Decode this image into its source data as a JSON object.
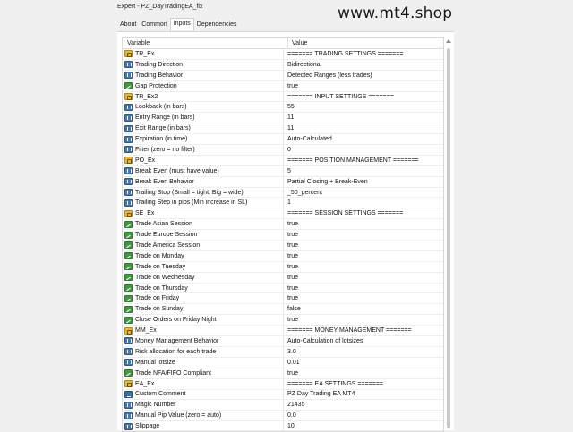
{
  "window": {
    "title": "Expert - PZ_DayTradingEA_fix",
    "watermark": "www.mt4.shop"
  },
  "tabs": [
    {
      "label": "About",
      "active": false
    },
    {
      "label": "Common",
      "active": false
    },
    {
      "label": "Inputs",
      "active": true
    },
    {
      "label": "Dependencies",
      "active": false
    }
  ],
  "table": {
    "col_variable": "Variable",
    "col_value": "Value",
    "rows": [
      {
        "icon": "str",
        "name": "TR_Ex",
        "value": "======= TRADING SETTINGS ======="
      },
      {
        "icon": "num",
        "name": "Trading Direction",
        "value": "Bidirectional"
      },
      {
        "icon": "num",
        "name": "Trading Behavior",
        "value": "Detected Ranges (less trades)"
      },
      {
        "icon": "bool",
        "name": "Gap Protection",
        "value": "true"
      },
      {
        "icon": "str",
        "name": "TR_Ex2",
        "value": "======= INPUT SETTINGS ======="
      },
      {
        "icon": "num",
        "name": "Lookback (in bars)",
        "value": "55"
      },
      {
        "icon": "num",
        "name": "Entry Range (in bars)",
        "value": "11"
      },
      {
        "icon": "num",
        "name": "Exit Range (in bars)",
        "value": "11"
      },
      {
        "icon": "num",
        "name": "Expiration (in time)",
        "value": "Auto-Calculated"
      },
      {
        "icon": "num",
        "name": "Filter (zero = no filter)",
        "value": "0"
      },
      {
        "icon": "str",
        "name": "PO_Ex",
        "value": "======= POSITION MANAGEMENT ======="
      },
      {
        "icon": "num",
        "name": "Break Even (must have value)",
        "value": "5"
      },
      {
        "icon": "num",
        "name": "Break Even Behavior",
        "value": "Partial Closing + Break-Even"
      },
      {
        "icon": "num",
        "name": "Trailing Stop (Small = tight, Big = wide)",
        "value": "_50_percent"
      },
      {
        "icon": "num",
        "name": "Trailing Step in pips (Min increase in SL)",
        "value": "1"
      },
      {
        "icon": "str",
        "name": "SE_Ex",
        "value": "======= SESSION SETTINGS ======="
      },
      {
        "icon": "bool",
        "name": "Trade Asian Session",
        "value": "true"
      },
      {
        "icon": "bool",
        "name": "Trade Europe Session",
        "value": "true"
      },
      {
        "icon": "bool",
        "name": "Trade America Session",
        "value": "true"
      },
      {
        "icon": "bool",
        "name": "Trade on Monday",
        "value": "true"
      },
      {
        "icon": "bool",
        "name": "Trade on Tuesday",
        "value": "true"
      },
      {
        "icon": "bool",
        "name": "Trade on Wednesday",
        "value": "true"
      },
      {
        "icon": "bool",
        "name": "Trade on Thursday",
        "value": "true"
      },
      {
        "icon": "bool",
        "name": "Trade on Friday",
        "value": "true"
      },
      {
        "icon": "bool",
        "name": "Trade on Sunday",
        "value": "false"
      },
      {
        "icon": "bool",
        "name": "Close Orders on Friday Night",
        "value": "true"
      },
      {
        "icon": "str",
        "name": "MM_Ex",
        "value": "======= MONEY MANAGEMENT ======="
      },
      {
        "icon": "num",
        "name": "Money Management Behavior",
        "value": "Auto-Calculation of lotsizes"
      },
      {
        "icon": "num",
        "name": "Risk allocation for each trade",
        "value": "3.0"
      },
      {
        "icon": "num",
        "name": "Manual lotsize",
        "value": "0.01"
      },
      {
        "icon": "bool",
        "name": "Trade NFA/FIFO Compliant",
        "value": "true"
      },
      {
        "icon": "str",
        "name": "EA_Ex",
        "value": "======= EA SETTINGS ======="
      },
      {
        "icon": "ab",
        "name": "Custom Comment",
        "value": "PZ Day Trading EA MT4"
      },
      {
        "icon": "num",
        "name": "Magic Number",
        "value": "21435"
      },
      {
        "icon": "num",
        "name": "Manual Pip Value (zero = auto)",
        "value": "0.0"
      },
      {
        "icon": "num",
        "name": "Slippage",
        "value": "10"
      }
    ]
  }
}
